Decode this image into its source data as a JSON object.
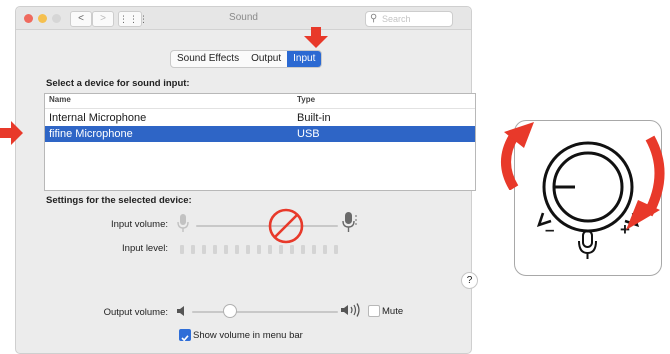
{
  "window": {
    "title": "Sound",
    "nav_back": "<",
    "nav_forward": ">",
    "nav_grid": "⋮⋮⋮",
    "search_placeholder": "Search"
  },
  "tabs": [
    {
      "label": "Sound Effects",
      "active": false
    },
    {
      "label": "Output",
      "active": false
    },
    {
      "label": "Input",
      "active": true
    }
  ],
  "device_section_label": "Select a device for sound input:",
  "table": {
    "columns": [
      "Name",
      "Type"
    ],
    "rows": [
      {
        "name": "Internal Microphone",
        "type": "Built-in",
        "selected": false
      },
      {
        "name": "fifine Microphone",
        "type": "USB",
        "selected": true
      }
    ]
  },
  "settings_label": "Settings for the selected device:",
  "input_volume_label": "Input volume:",
  "input_level_label": "Input level:",
  "input_level_segments": 15,
  "help_label": "?",
  "output_volume_label": "Output volume:",
  "output_volume_fraction": 0.25,
  "mute_label": "Mute",
  "mute_checked": false,
  "show_volume_label": "Show volume in menu bar",
  "show_volume_checked": true,
  "colors": {
    "selection": "#2e65c6",
    "annotation_red": "#e8392a",
    "tab_active": "#2b69d2"
  },
  "icons": [
    "microphone-icon",
    "no-sign-icon",
    "speaker-icon",
    "gain-knob-icon",
    "curved-arrow-icon"
  ],
  "illustration": {
    "minus_label": "–",
    "plus_label": "+"
  }
}
